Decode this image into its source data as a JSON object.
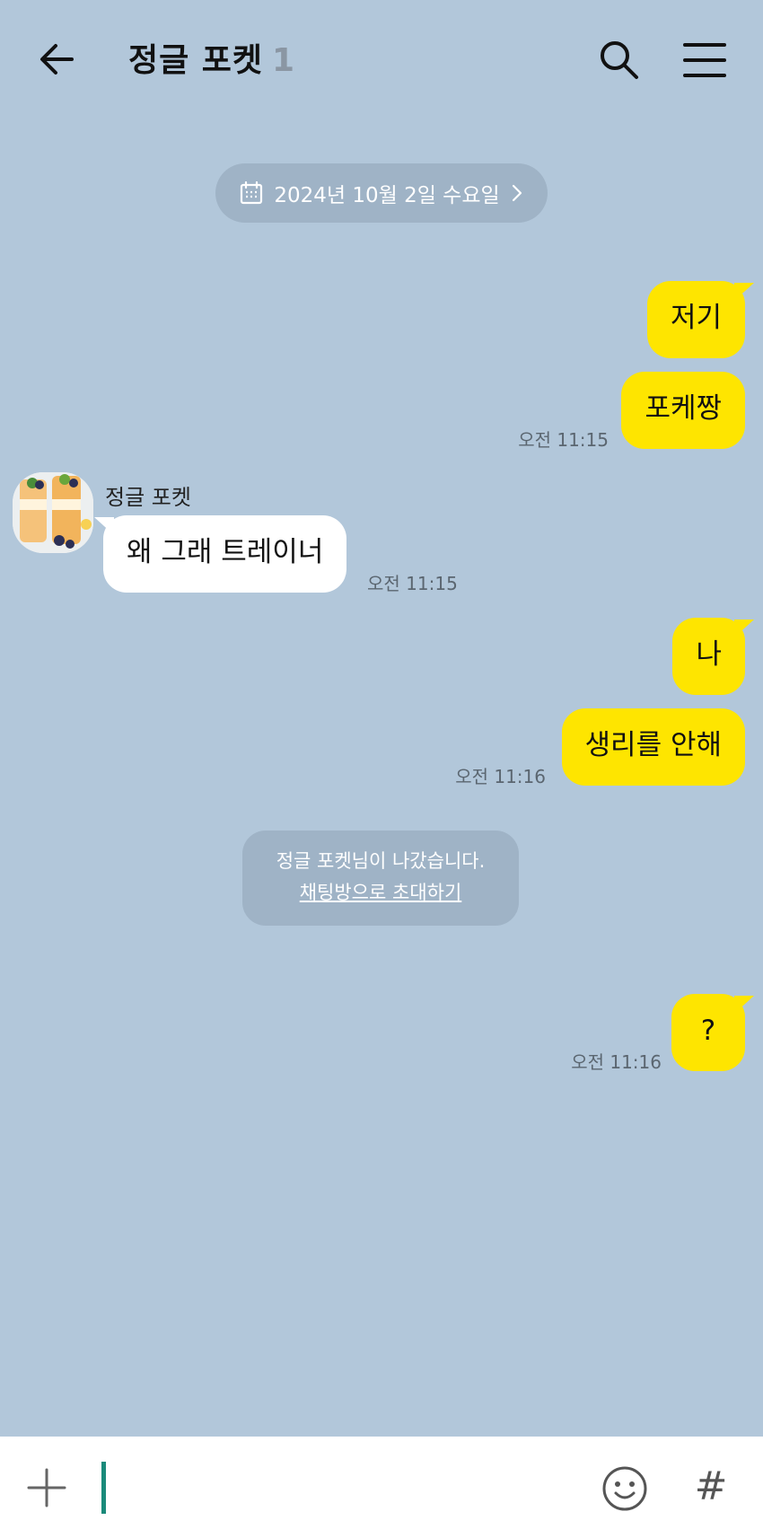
{
  "header": {
    "title": "정글 포켓",
    "member_count": "1"
  },
  "date_divider": {
    "label": "2024년 10월 2일 수요일"
  },
  "messages": [
    {
      "sender": "me",
      "text": "저기"
    },
    {
      "sender": "me",
      "text": "포케짱",
      "time": "오전 11:15"
    },
    {
      "sender": "other",
      "name": "정글 포켓",
      "text": "왜 그래 트레이너",
      "time": "오전 11:15"
    },
    {
      "sender": "me",
      "text": "나"
    },
    {
      "sender": "me",
      "text": "생리를 안해",
      "time": "오전 11:16"
    },
    {
      "sender": "me",
      "text": "?",
      "time": "오전 11:16"
    }
  ],
  "system_notice": {
    "text": "정글 포켓님이 나갔습니다.",
    "link": "채팅방으로 초대하기"
  },
  "input_bar": {
    "value": "",
    "hash_label": "#"
  },
  "colors": {
    "background": "#b2c7da",
    "my_bubble": "#fee500",
    "other_bubble": "#ffffff",
    "pill": "#9fb3c6"
  }
}
